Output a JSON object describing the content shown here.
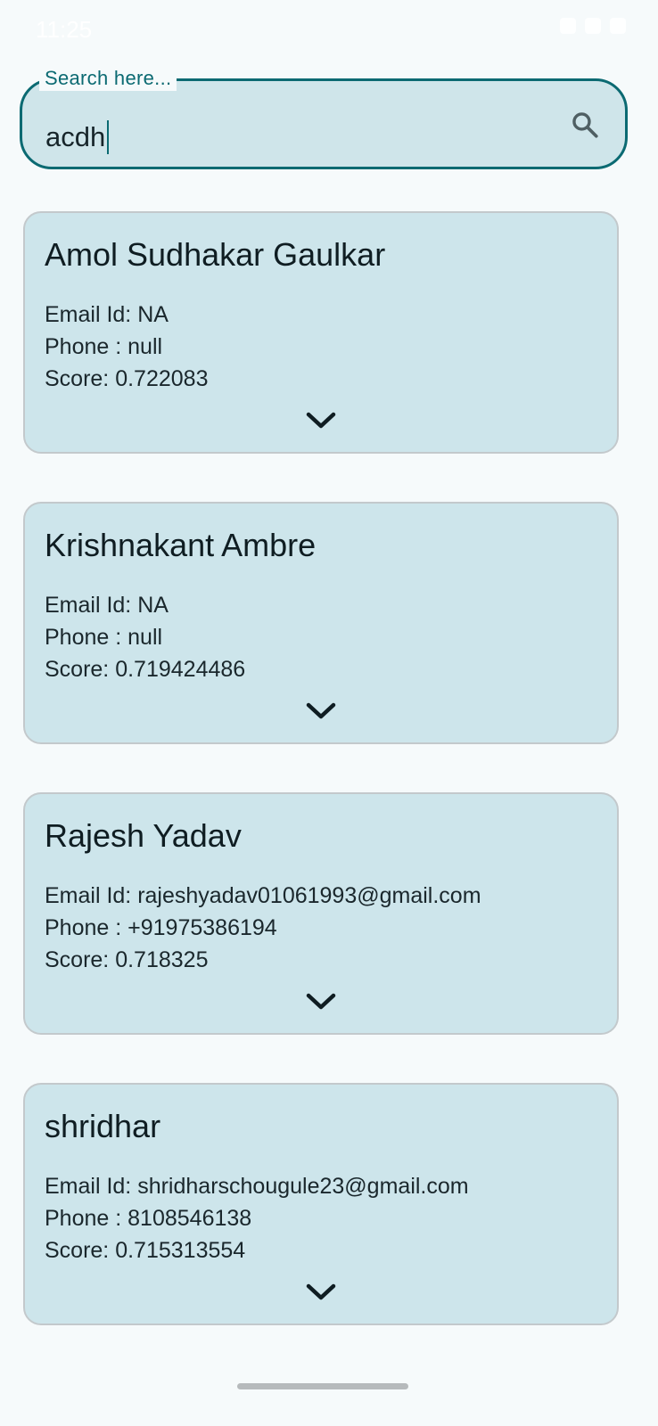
{
  "status_bar": {
    "time": "11:25"
  },
  "search": {
    "label": "Search here...",
    "value": "acdh",
    "icon": "search-icon"
  },
  "results": [
    {
      "name": "Amol Sudhakar Gaulkar",
      "email_prefix": "Email Id: ",
      "email": "NA",
      "phone_prefix": "Phone : ",
      "phone": "null",
      "score_prefix": "Score: ",
      "score": "0.722083",
      "expand_icon": "chevron-down-icon"
    },
    {
      "name": "Krishnakant Ambre",
      "email_prefix": "Email Id: ",
      "email": "NA",
      "phone_prefix": "Phone : ",
      "phone": "null",
      "score_prefix": "Score: ",
      "score": "0.719424486",
      "expand_icon": "chevron-down-icon"
    },
    {
      "name": "Rajesh Yadav",
      "email_prefix": "Email Id: ",
      "email": "rajeshyadav01061993@gmail.com",
      "phone_prefix": "Phone : ",
      "phone": "+91975386194",
      "score_prefix": "Score: ",
      "score": "0.718325",
      "expand_icon": "chevron-down-icon"
    },
    {
      "name": "shridhar",
      "email_prefix": "Email Id: ",
      "email": "shridharschougule23@gmail.com",
      "phone_prefix": "Phone : ",
      "phone": "8108546138",
      "score_prefix": "Score: ",
      "score": "0.715313554",
      "expand_icon": "chevron-down-icon"
    }
  ],
  "colors": {
    "accent": "#0b6a72",
    "card_background": "#cde5eb",
    "page_background": "#f6fafb"
  }
}
